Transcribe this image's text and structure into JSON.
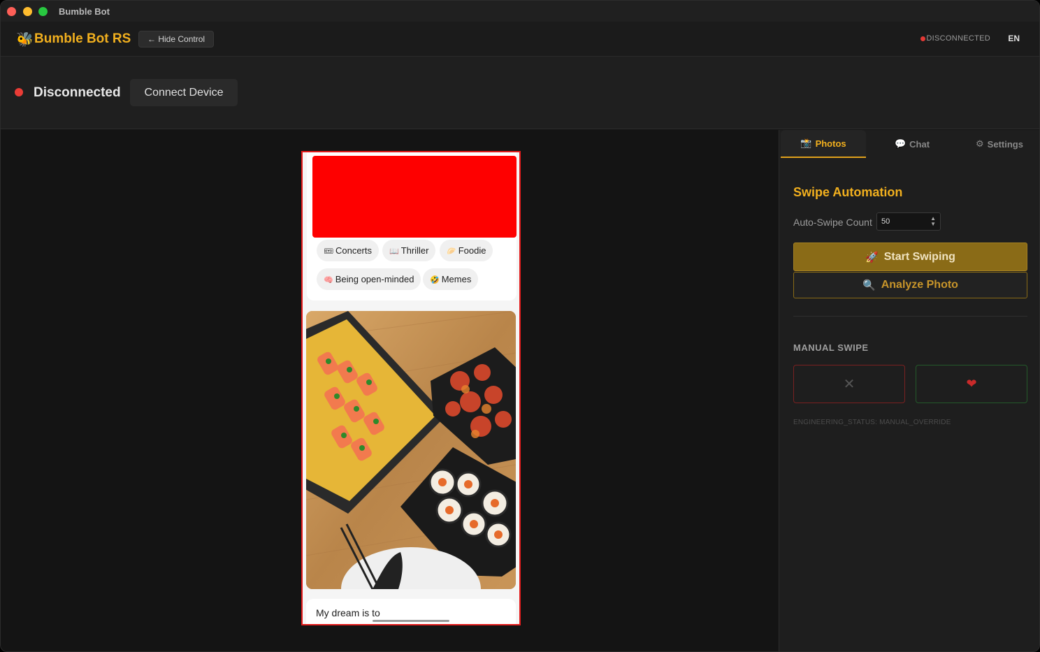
{
  "window": {
    "title": "Bumble Bot"
  },
  "header": {
    "brand_icon": "🐝",
    "brand": "Bumble Bot RS",
    "hide_control": "← Hide Control",
    "status": "DISCONNECTED",
    "lang": "EN"
  },
  "connection": {
    "status": "Disconnected",
    "connect_button": "Connect Device"
  },
  "profile": {
    "tags": [
      {
        "icon": "🎟",
        "label": "Concerts"
      },
      {
        "icon": "📖",
        "label": "Thriller"
      },
      {
        "icon": "🥟",
        "label": "Foodie"
      },
      {
        "icon": "🧠",
        "label": "Being open-minded"
      },
      {
        "icon": "🤣",
        "label": "Memes"
      }
    ],
    "prompt_text": "My dream is to"
  },
  "panel": {
    "tabs": [
      {
        "icon": "📸",
        "label": "Photos"
      },
      {
        "icon": "💬",
        "label": "Chat"
      },
      {
        "icon": "⚙",
        "label": "Settings"
      }
    ],
    "section_title": "Swipe Automation",
    "count_label": "Auto-Swipe Count",
    "count_value": "50",
    "start_icon": "🚀",
    "start_button": "Start Swiping",
    "analyze_icon": "🔍",
    "analyze_button": "Analyze Photo",
    "manual_title": "MANUAL SWIPE",
    "nope_symbol": "✕",
    "like_symbol": "❤",
    "engineering_status": "ENGINEERING_STATUS: MANUAL_OVERRIDE"
  },
  "colors": {
    "accent": "#f2b01e",
    "start_button_bg": "#8a6b17",
    "status_red": "#ea3c36",
    "phone_border": "#e31b1b",
    "redacted_block": "#fe0000"
  }
}
